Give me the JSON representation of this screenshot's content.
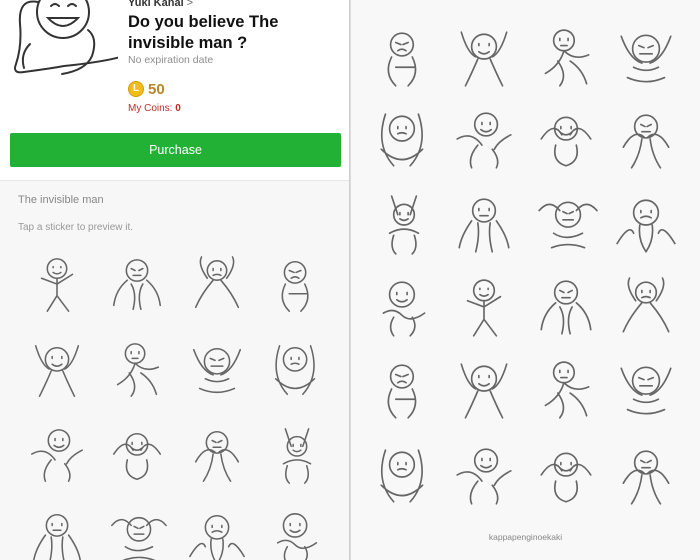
{
  "product": {
    "author": "Yuki Kanai",
    "title": "Do you believe The invisible man ?",
    "expiry": "No expiration date",
    "price": "50",
    "my_coins_label": "My Coins:",
    "my_coins_value": "0",
    "coin_color": "#f2bd1a",
    "purchase_label": "Purchase",
    "purchase_color": "#22b135"
  },
  "pack": {
    "name": "The invisible man",
    "hint": "Tap a sticker to preview it."
  },
  "credit": "kappapenginoekaki",
  "icons": {
    "author_link": "chevron-right-icon",
    "coin": "line-coin-icon",
    "sticker": "stick-figure-sticker"
  }
}
